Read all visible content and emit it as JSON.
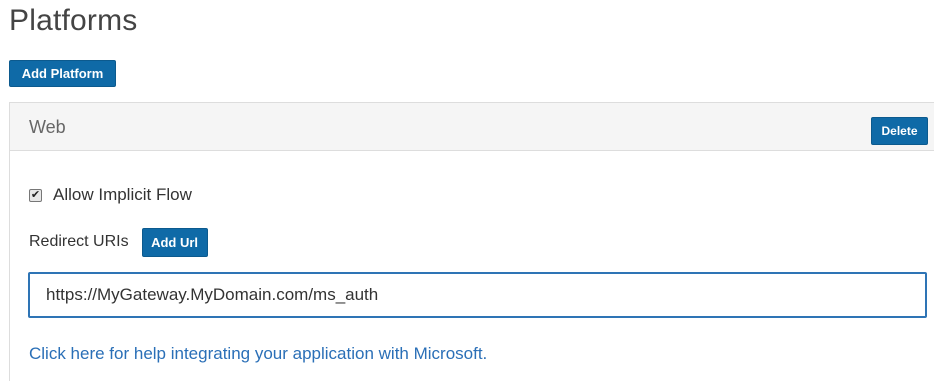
{
  "page": {
    "title": "Platforms",
    "add_platform_label": "Add Platform"
  },
  "platform": {
    "name": "Web",
    "delete_label": "Delete",
    "allow_implicit_flow": {
      "label": "Allow Implicit Flow",
      "checked": true
    },
    "redirect_uris": {
      "label": "Redirect URIs",
      "add_url_label": "Add Url",
      "values": [
        "https://MyGateway.MyDomain.com/ms_auth"
      ]
    },
    "help_link_text": "Click here for help integrating your application with Microsoft."
  },
  "colors": {
    "button_blue": "#0f6aa7",
    "link_blue": "#2a6fb7",
    "input_border": "#2e74b5",
    "panel_header_bg": "#f5f5f5"
  },
  "icons": {
    "checkbox": "check-icon"
  }
}
